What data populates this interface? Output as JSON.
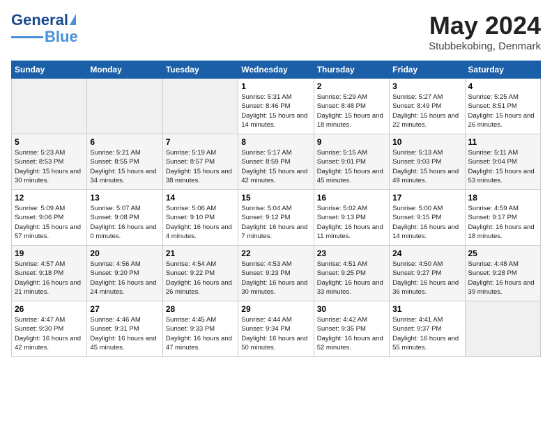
{
  "header": {
    "logo": {
      "line1": "General",
      "line2": "Blue"
    },
    "title": "May 2024",
    "location": "Stubbekobing, Denmark"
  },
  "weekdays": [
    "Sunday",
    "Monday",
    "Tuesday",
    "Wednesday",
    "Thursday",
    "Friday",
    "Saturday"
  ],
  "weeks": [
    [
      {
        "day": "",
        "empty": true
      },
      {
        "day": "",
        "empty": true
      },
      {
        "day": "",
        "empty": true
      },
      {
        "day": "1",
        "sunrise": "Sunrise: 5:31 AM",
        "sunset": "Sunset: 8:46 PM",
        "daylight": "Daylight: 15 hours and 14 minutes."
      },
      {
        "day": "2",
        "sunrise": "Sunrise: 5:29 AM",
        "sunset": "Sunset: 8:48 PM",
        "daylight": "Daylight: 15 hours and 18 minutes."
      },
      {
        "day": "3",
        "sunrise": "Sunrise: 5:27 AM",
        "sunset": "Sunset: 8:49 PM",
        "daylight": "Daylight: 15 hours and 22 minutes."
      },
      {
        "day": "4",
        "sunrise": "Sunrise: 5:25 AM",
        "sunset": "Sunset: 8:51 PM",
        "daylight": "Daylight: 15 hours and 26 minutes."
      }
    ],
    [
      {
        "day": "5",
        "sunrise": "Sunrise: 5:23 AM",
        "sunset": "Sunset: 8:53 PM",
        "daylight": "Daylight: 15 hours and 30 minutes."
      },
      {
        "day": "6",
        "sunrise": "Sunrise: 5:21 AM",
        "sunset": "Sunset: 8:55 PM",
        "daylight": "Daylight: 15 hours and 34 minutes."
      },
      {
        "day": "7",
        "sunrise": "Sunrise: 5:19 AM",
        "sunset": "Sunset: 8:57 PM",
        "daylight": "Daylight: 15 hours and 38 minutes."
      },
      {
        "day": "8",
        "sunrise": "Sunrise: 5:17 AM",
        "sunset": "Sunset: 8:59 PM",
        "daylight": "Daylight: 15 hours and 42 minutes."
      },
      {
        "day": "9",
        "sunrise": "Sunrise: 5:15 AM",
        "sunset": "Sunset: 9:01 PM",
        "daylight": "Daylight: 15 hours and 45 minutes."
      },
      {
        "day": "10",
        "sunrise": "Sunrise: 5:13 AM",
        "sunset": "Sunset: 9:03 PM",
        "daylight": "Daylight: 15 hours and 49 minutes."
      },
      {
        "day": "11",
        "sunrise": "Sunrise: 5:11 AM",
        "sunset": "Sunset: 9:04 PM",
        "daylight": "Daylight: 15 hours and 53 minutes."
      }
    ],
    [
      {
        "day": "12",
        "sunrise": "Sunrise: 5:09 AM",
        "sunset": "Sunset: 9:06 PM",
        "daylight": "Daylight: 15 hours and 57 minutes."
      },
      {
        "day": "13",
        "sunrise": "Sunrise: 5:07 AM",
        "sunset": "Sunset: 9:08 PM",
        "daylight": "Daylight: 16 hours and 0 minutes."
      },
      {
        "day": "14",
        "sunrise": "Sunrise: 5:06 AM",
        "sunset": "Sunset: 9:10 PM",
        "daylight": "Daylight: 16 hours and 4 minutes."
      },
      {
        "day": "15",
        "sunrise": "Sunrise: 5:04 AM",
        "sunset": "Sunset: 9:12 PM",
        "daylight": "Daylight: 16 hours and 7 minutes."
      },
      {
        "day": "16",
        "sunrise": "Sunrise: 5:02 AM",
        "sunset": "Sunset: 9:13 PM",
        "daylight": "Daylight: 16 hours and 11 minutes."
      },
      {
        "day": "17",
        "sunrise": "Sunrise: 5:00 AM",
        "sunset": "Sunset: 9:15 PM",
        "daylight": "Daylight: 16 hours and 14 minutes."
      },
      {
        "day": "18",
        "sunrise": "Sunrise: 4:59 AM",
        "sunset": "Sunset: 9:17 PM",
        "daylight": "Daylight: 16 hours and 18 minutes."
      }
    ],
    [
      {
        "day": "19",
        "sunrise": "Sunrise: 4:57 AM",
        "sunset": "Sunset: 9:18 PM",
        "daylight": "Daylight: 16 hours and 21 minutes."
      },
      {
        "day": "20",
        "sunrise": "Sunrise: 4:56 AM",
        "sunset": "Sunset: 9:20 PM",
        "daylight": "Daylight: 16 hours and 24 minutes."
      },
      {
        "day": "21",
        "sunrise": "Sunrise: 4:54 AM",
        "sunset": "Sunset: 9:22 PM",
        "daylight": "Daylight: 16 hours and 26 minutes."
      },
      {
        "day": "22",
        "sunrise": "Sunrise: 4:53 AM",
        "sunset": "Sunset: 9:23 PM",
        "daylight": "Daylight: 16 hours and 30 minutes."
      },
      {
        "day": "23",
        "sunrise": "Sunrise: 4:51 AM",
        "sunset": "Sunset: 9:25 PM",
        "daylight": "Daylight: 16 hours and 33 minutes."
      },
      {
        "day": "24",
        "sunrise": "Sunrise: 4:50 AM",
        "sunset": "Sunset: 9:27 PM",
        "daylight": "Daylight: 16 hours and 36 minutes."
      },
      {
        "day": "25",
        "sunrise": "Sunrise: 4:48 AM",
        "sunset": "Sunset: 9:28 PM",
        "daylight": "Daylight: 16 hours and 39 minutes."
      }
    ],
    [
      {
        "day": "26",
        "sunrise": "Sunrise: 4:47 AM",
        "sunset": "Sunset: 9:30 PM",
        "daylight": "Daylight: 16 hours and 42 minutes."
      },
      {
        "day": "27",
        "sunrise": "Sunrise: 4:46 AM",
        "sunset": "Sunset: 9:31 PM",
        "daylight": "Daylight: 16 hours and 45 minutes."
      },
      {
        "day": "28",
        "sunrise": "Sunrise: 4:45 AM",
        "sunset": "Sunset: 9:33 PM",
        "daylight": "Daylight: 16 hours and 47 minutes."
      },
      {
        "day": "29",
        "sunrise": "Sunrise: 4:44 AM",
        "sunset": "Sunset: 9:34 PM",
        "daylight": "Daylight: 16 hours and 50 minutes."
      },
      {
        "day": "30",
        "sunrise": "Sunrise: 4:42 AM",
        "sunset": "Sunset: 9:35 PM",
        "daylight": "Daylight: 16 hours and 52 minutes."
      },
      {
        "day": "31",
        "sunrise": "Sunrise: 4:41 AM",
        "sunset": "Sunset: 9:37 PM",
        "daylight": "Daylight: 16 hours and 55 minutes."
      },
      {
        "day": "",
        "empty": true
      }
    ]
  ]
}
